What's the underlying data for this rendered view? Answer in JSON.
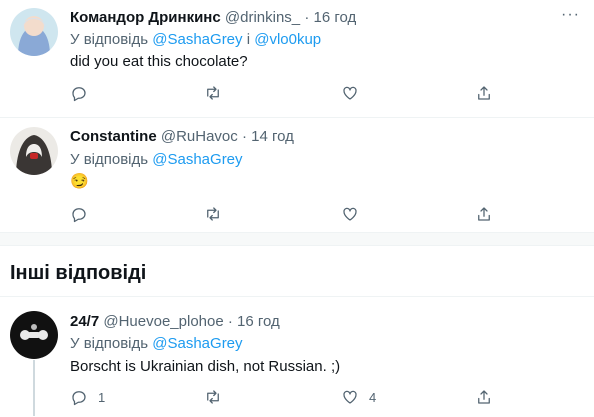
{
  "tweets": [
    {
      "author_name": "Командор Дринкинс",
      "handle": "@drinkins_",
      "sep": "·",
      "time": "16 год",
      "reply_prefix": "У відповідь",
      "mention1": "@SashaGrey",
      "joiner": "і",
      "mention2": "@vlo0kup",
      "text": "did you eat this chocolate?"
    },
    {
      "author_name": "Constantine",
      "handle": "@RuHavoc",
      "sep": "·",
      "time": "14 год",
      "reply_prefix": "У відповідь",
      "mention1": "@SashaGrey",
      "text": "😏"
    }
  ],
  "more_label": "···",
  "section": {
    "title": "Інші відповіді"
  },
  "other_reply": {
    "author_name": "24/7",
    "handle": "@Huevoe_plohoe",
    "sep": "·",
    "time": "16 год",
    "reply_prefix": "У відповідь",
    "mention1": "@SashaGrey",
    "text": "Borscht is Ukrainian dish, not Russian. ;)",
    "reply_count": "1",
    "like_count": "4"
  },
  "colors": {
    "link": "#1d9bf0",
    "muted": "#536471",
    "text": "#0f1419"
  }
}
